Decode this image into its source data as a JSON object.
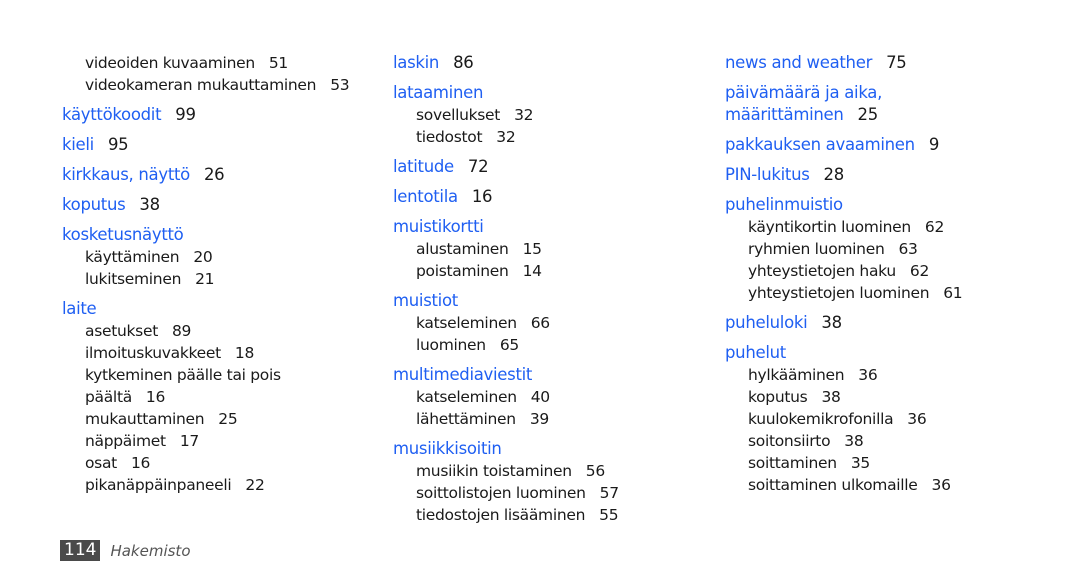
{
  "columns": [
    [
      {
        "type": "sub",
        "term": "videoiden kuvaaminen",
        "page": "51"
      },
      {
        "type": "sub",
        "term": "videokameran mukauttaminen",
        "page": "53"
      },
      {
        "type": "main",
        "term": "käyttökoodit",
        "page": "99"
      },
      {
        "type": "main",
        "term": "kieli",
        "page": "95"
      },
      {
        "type": "main",
        "term": "kirkkaus, näyttö",
        "page": "26"
      },
      {
        "type": "main",
        "term": "koputus",
        "page": "38"
      },
      {
        "type": "main",
        "term": "kosketusnäyttö",
        "page": ""
      },
      {
        "type": "sub",
        "term": "käyttäminen",
        "page": "20"
      },
      {
        "type": "sub",
        "term": "lukitseminen",
        "page": "21"
      },
      {
        "type": "main",
        "term": "laite",
        "page": ""
      },
      {
        "type": "sub",
        "term": "asetukset",
        "page": "89"
      },
      {
        "type": "sub",
        "term": "ilmoituskuvakkeet",
        "page": "18"
      },
      {
        "type": "sub",
        "term": "kytkeminen päälle tai pois\npäältä",
        "page": "16"
      },
      {
        "type": "sub",
        "term": "mukauttaminen",
        "page": "25"
      },
      {
        "type": "sub",
        "term": "näppäimet",
        "page": "17"
      },
      {
        "type": "sub",
        "term": "osat",
        "page": "16"
      },
      {
        "type": "sub",
        "term": "pikanäppäinpaneeli",
        "page": "22"
      }
    ],
    [
      {
        "type": "main",
        "term": "laskin",
        "page": "86"
      },
      {
        "type": "main",
        "term": "lataaminen",
        "page": ""
      },
      {
        "type": "sub",
        "term": "sovellukset",
        "page": "32"
      },
      {
        "type": "sub",
        "term": "tiedostot",
        "page": "32"
      },
      {
        "type": "main",
        "term": "latitude",
        "page": "72"
      },
      {
        "type": "main",
        "term": "lentotila",
        "page": "16"
      },
      {
        "type": "main",
        "term": "muistikortti",
        "page": ""
      },
      {
        "type": "sub",
        "term": "alustaminen",
        "page": "15"
      },
      {
        "type": "sub",
        "term": "poistaminen",
        "page": "14"
      },
      {
        "type": "main",
        "term": "muistiot",
        "page": ""
      },
      {
        "type": "sub",
        "term": "katseleminen",
        "page": "66"
      },
      {
        "type": "sub",
        "term": "luominen",
        "page": "65"
      },
      {
        "type": "main",
        "term": "multimediaviestit",
        "page": ""
      },
      {
        "type": "sub",
        "term": "katseleminen",
        "page": "40"
      },
      {
        "type": "sub",
        "term": "lähettäminen",
        "page": "39"
      },
      {
        "type": "main",
        "term": "musiikkisoitin",
        "page": ""
      },
      {
        "type": "sub",
        "term": "musiikin toistaminen",
        "page": "56"
      },
      {
        "type": "sub",
        "term": "soittolistojen luominen",
        "page": "57"
      },
      {
        "type": "sub",
        "term": "tiedostojen lisääminen",
        "page": "55"
      }
    ],
    [
      {
        "type": "main",
        "term": "news and weather",
        "page": "75"
      },
      {
        "type": "main",
        "term": "päivämäärä ja aika,\nmäärittäminen",
        "page": "25"
      },
      {
        "type": "main",
        "term": "pakkauksen avaaminen",
        "page": "9"
      },
      {
        "type": "main",
        "term": "PIN-lukitus",
        "page": "28"
      },
      {
        "type": "main",
        "term": "puhelinmuistio",
        "page": ""
      },
      {
        "type": "sub",
        "term": "käyntikortin luominen",
        "page": "62"
      },
      {
        "type": "sub",
        "term": "ryhmien luominen",
        "page": "63"
      },
      {
        "type": "sub",
        "term": "yhteystietojen haku",
        "page": "62"
      },
      {
        "type": "sub",
        "term": "yhteystietojen luominen",
        "page": "61"
      },
      {
        "type": "main",
        "term": "puheluloki",
        "page": "38"
      },
      {
        "type": "main",
        "term": "puhelut",
        "page": ""
      },
      {
        "type": "sub",
        "term": "hylkääminen",
        "page": "36"
      },
      {
        "type": "sub",
        "term": "koputus",
        "page": "38"
      },
      {
        "type": "sub",
        "term": "kuulokemikrofonilla",
        "page": "36"
      },
      {
        "type": "sub",
        "term": "soitonsiirto",
        "page": "38"
      },
      {
        "type": "sub",
        "term": "soittaminen",
        "page": "35"
      },
      {
        "type": "sub",
        "term": "soittaminen ulkomaille",
        "page": "36"
      }
    ]
  ],
  "footer": {
    "page_number": "114",
    "section": "Hakemisto"
  },
  "colors": {
    "term": "#1f5ff2",
    "text": "#1a1a1a",
    "page_box": "#4a4a4a"
  }
}
